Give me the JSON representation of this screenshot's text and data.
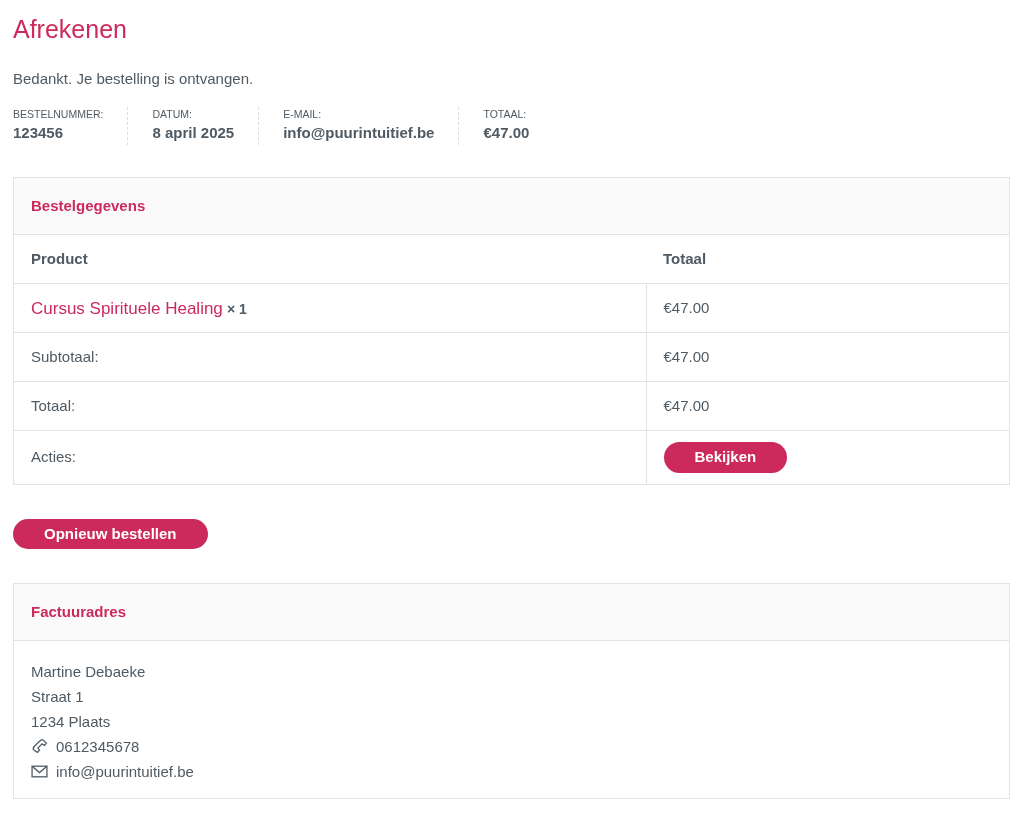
{
  "page_title": "Afrekenen",
  "notice": "Bedankt. Je bestelling is ontvangen.",
  "overview": [
    {
      "label": "BESTELNUMMER:",
      "value": "123456"
    },
    {
      "label": "DATUM:",
      "value": "8 april 2025"
    },
    {
      "label": "E-MAIL:",
      "value": "info@puurintuitief.be"
    },
    {
      "label": "TOTAAL:",
      "value": "€47.00"
    }
  ],
  "order_details": {
    "title": "Bestelgegevens",
    "columns": [
      "Product",
      "Totaal"
    ],
    "items": [
      {
        "product": "Cursus Spirituele Healing",
        "quantity": "× 1",
        "total": "€47.00"
      }
    ],
    "totals": [
      {
        "kind": "text",
        "label": "Subtotaal:",
        "value": "€47.00"
      },
      {
        "kind": "text",
        "label": "Totaal:",
        "value": "€47.00"
      },
      {
        "kind": "button",
        "label": "Acties:",
        "value": "Bekijken"
      }
    ]
  },
  "order_again_button": "Opnieuw bestellen",
  "billing_address": {
    "title": "Factuuradres",
    "lines": [
      {
        "kind": "text",
        "text": "Martine Debaeke"
      },
      {
        "kind": "text",
        "text": "Straat 1"
      },
      {
        "kind": "text",
        "text": "1234 Plaats"
      },
      {
        "kind": "phone",
        "text": "0612345678"
      },
      {
        "kind": "email",
        "text": "info@puurintuitief.be"
      }
    ]
  }
}
